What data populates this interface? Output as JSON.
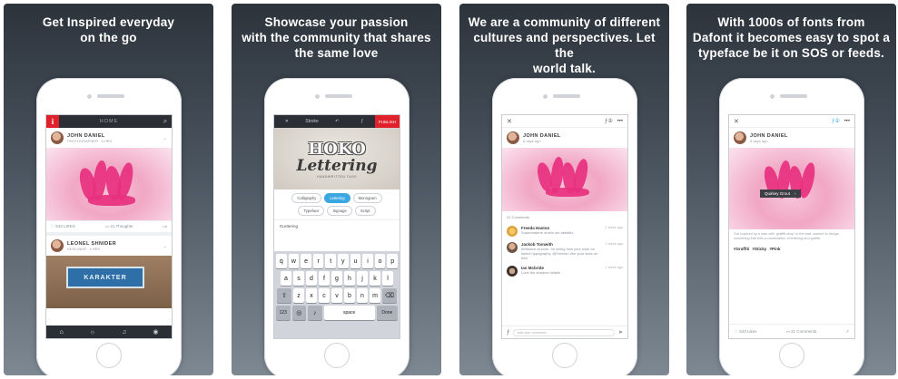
{
  "panels": [
    {
      "caption": "Get Inspired everyday\non the go"
    },
    {
      "caption": "Showcase your passion\nwith the community that shares\nthe same love"
    },
    {
      "caption": "We are a community of different\ncultures and perspectives. Let the\nworld talk."
    },
    {
      "caption": "With 1000s of fonts from\nDafont it becomes easy to spot a\ntypeface be it on SOS or feeds."
    }
  ],
  "screen1": {
    "logo": "i",
    "title": "HOME",
    "post1": {
      "name": "JOHN DANIEL",
      "sub": "PHOTOGRAPHER · 8 HRS",
      "likes": "♡ 543 LIKES",
      "comments": "▭ 21 Thoughts"
    },
    "post2": {
      "name": "LEONEL SHNIDER",
      "sub": "DESIGNER · 4 HRS",
      "sign": "KARAKTER"
    }
  },
  "screen2": {
    "close": "✕",
    "brush": "Stroke",
    "undo": "↶",
    "font": "ƒ",
    "publish": "PUBLISH",
    "art": {
      "top": "HOKO",
      "main": "Lettering",
      "sub": "HANDWRITTEN TAGS"
    },
    "chips": [
      {
        "label": "Calligraphy",
        "active": false
      },
      {
        "label": "Lettering",
        "active": true
      },
      {
        "label": "Monogram",
        "active": false
      },
      {
        "label": "Typeface",
        "active": false
      },
      {
        "label": "Signage",
        "active": false
      },
      {
        "label": "Script",
        "active": false
      }
    ],
    "tag": "#Lettering",
    "keyboard": {
      "row1": [
        "q",
        "w",
        "e",
        "r",
        "t",
        "y",
        "u",
        "i",
        "o",
        "p"
      ],
      "row2": [
        "a",
        "s",
        "d",
        "f",
        "g",
        "h",
        "j",
        "k",
        "l"
      ],
      "row3": [
        "z",
        "x",
        "c",
        "v",
        "b",
        "n",
        "m"
      ],
      "shift": "⇧",
      "backspace": "⌫",
      "num": "123",
      "globe": "◎",
      "mic": "♪",
      "space": "space",
      "done": "Done"
    }
  },
  "screen3": {
    "close": "✕",
    "font_icon": "ƒ②",
    "more": "•••",
    "post": {
      "name": "JOHN DANIEL",
      "sub": "8 days ago"
    },
    "comments_label": "31 Comments",
    "comments": [
      {
        "name": "Freeda Haston",
        "text": "Supermalerie oruelo dei dettallio",
        "time": "1 week ago"
      },
      {
        "name": "Jackob Tomwith",
        "text": "Brilliance at work. Im loving how your work on sketch typography. @Freeda i like your work on this!",
        "time": "1 week ago"
      },
      {
        "name": "Ian Mcbride",
        "text": "Love the shadow details",
        "time": "1 week ago"
      }
    ],
    "input_placeholder": "Add your comment..."
  },
  "screen4": {
    "close": "✕",
    "font_icon": "ƒ②",
    "more": "•••",
    "post": {
      "name": "JOHN DANIEL",
      "sub": "8 days ago"
    },
    "tooltip": "Quirkey Grout",
    "desc": "Got Inspired by a man with 'graffiti shop' in the wall, wanted to design something that tells a combination of lettering and graffiti.",
    "hashtags": "#Graffiti #Sticky #Pink",
    "likes": "♡ 543 Likes",
    "comments": "▭ 21 Comments",
    "share": "↗"
  }
}
